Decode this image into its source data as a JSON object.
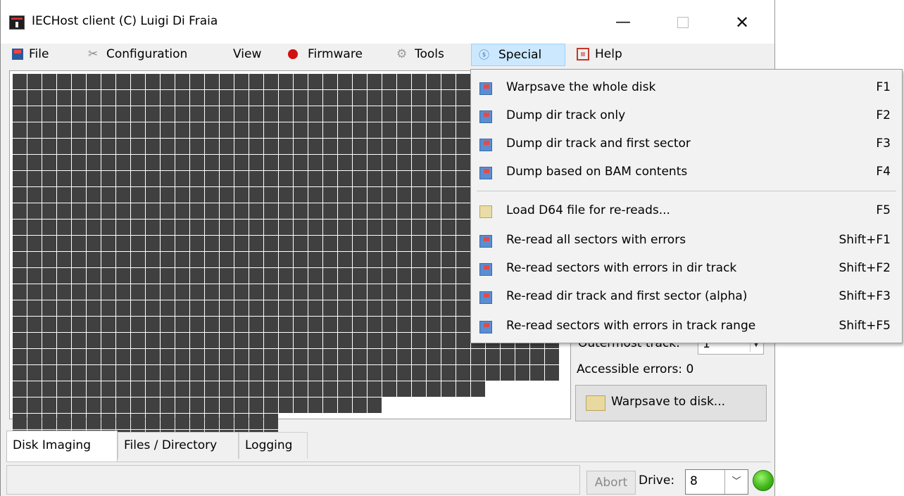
{
  "window": {
    "title": "IECHost client (C) Luigi Di Fraia",
    "minimize_glyph": "—",
    "close_glyph": "✕"
  },
  "menubar": {
    "items": [
      {
        "label": "File",
        "icon": "floppy-icon"
      },
      {
        "label": "Configuration",
        "icon": "wrench-icon"
      },
      {
        "label": "View",
        "icon": ""
      },
      {
        "label": "Firmware",
        "icon": "red-dot-icon"
      },
      {
        "label": "Tools",
        "icon": "gear-icon"
      },
      {
        "label": "Special",
        "icon": "special-icon"
      },
      {
        "label": "Help",
        "icon": "help-icon"
      }
    ]
  },
  "special_menu": {
    "items": [
      {
        "label": "Warpsave the whole disk",
        "shortcut": "F1"
      },
      {
        "label": "Dump dir track only",
        "shortcut": "F2"
      },
      {
        "label": "Dump dir track and first sector",
        "shortcut": "F3"
      },
      {
        "label": "Dump based on BAM contents",
        "shortcut": "F4"
      },
      {
        "label": "Load D64 file for re-reads...",
        "shortcut": "F5"
      },
      {
        "label": "Re-read all sectors with errors",
        "shortcut": "Shift+F1"
      },
      {
        "label": "Re-read sectors with errors in dir track",
        "shortcut": "Shift+F2"
      },
      {
        "label": "Re-read dir track and first sector (alpha)",
        "shortcut": "Shift+F3"
      },
      {
        "label": "Re-read sectors with errors in track range",
        "shortcut": "Shift+F5"
      }
    ]
  },
  "disk_grid": {
    "row_lengths": [
      37,
      37,
      37,
      37,
      37,
      37,
      37,
      37,
      37,
      37,
      37,
      37,
      37,
      37,
      37,
      37,
      37,
      37,
      37,
      32,
      25,
      18,
      18
    ],
    "cell_color": "#404040"
  },
  "side_panel": {
    "partial_label": "Outermost track:",
    "partial_value": "1",
    "accessible_errors": "Accessible errors: 0",
    "warpsave_button": "Warpsave to disk..."
  },
  "tabs": [
    {
      "label": "Disk Imaging",
      "active": true
    },
    {
      "label": "Files / Directory",
      "active": false
    },
    {
      "label": "Logging",
      "active": false
    }
  ],
  "statusbar": {
    "abort_label": "Abort",
    "drive_label": "Drive:",
    "drive_value": "8",
    "led_color": "#42b81b"
  }
}
